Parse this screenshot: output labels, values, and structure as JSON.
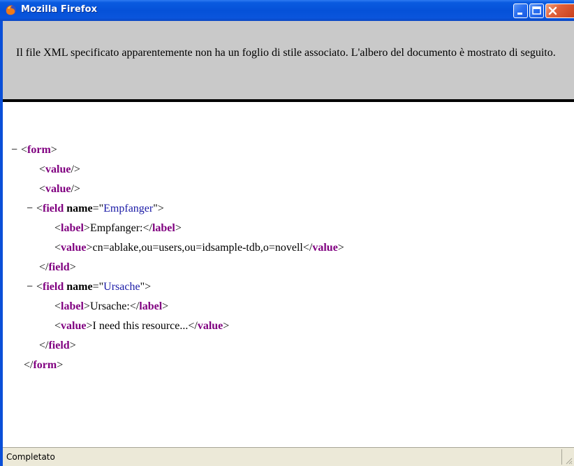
{
  "window": {
    "title": "Mozilla Firefox",
    "app_icon": "firefox-icon",
    "controls": {
      "minimize_icon": "minimize-icon",
      "maximize_icon": "maximize-icon",
      "close_icon": "close-icon"
    }
  },
  "info": {
    "message": "Il file XML specificato apparentemente non ha un foglio di stile associato. L'albero del documento è mostrato di seguito."
  },
  "xml": {
    "toggle_symbol": "−",
    "form_tag": "form",
    "value_tag": "value",
    "field_tag": "field",
    "label_tag": "label",
    "name_attr": "name",
    "field1": {
      "name_value": "Empfanger",
      "label_text": "Empfanger:",
      "value_text": "cn=ablake,ou=users,ou=idsample-tdb,o=novell"
    },
    "field2": {
      "name_value": "Ursache",
      "label_text": "Ursache:",
      "value_text": "I need this resource..."
    }
  },
  "status": {
    "text": "Completato"
  },
  "colors": {
    "titlebar": "#0551d8",
    "tag": "#800080",
    "attr_value": "#1a1aa6",
    "info_bar": "#c9c9c9",
    "statusbar": "#ece9d8"
  }
}
